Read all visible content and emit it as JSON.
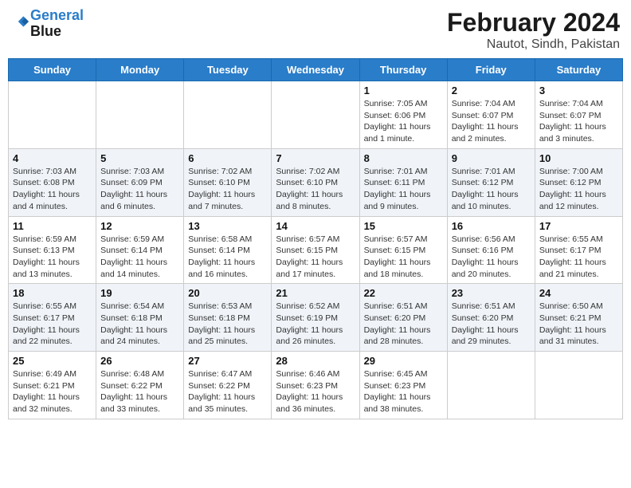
{
  "header": {
    "logo_line1": "General",
    "logo_line2": "Blue",
    "month_year": "February 2024",
    "location": "Nautot, Sindh, Pakistan"
  },
  "days_of_week": [
    "Sunday",
    "Monday",
    "Tuesday",
    "Wednesday",
    "Thursday",
    "Friday",
    "Saturday"
  ],
  "weeks": [
    [
      {
        "day": "",
        "info": ""
      },
      {
        "day": "",
        "info": ""
      },
      {
        "day": "",
        "info": ""
      },
      {
        "day": "",
        "info": ""
      },
      {
        "day": "1",
        "info": "Sunrise: 7:05 AM\nSunset: 6:06 PM\nDaylight: 11 hours and 1 minute."
      },
      {
        "day": "2",
        "info": "Sunrise: 7:04 AM\nSunset: 6:07 PM\nDaylight: 11 hours and 2 minutes."
      },
      {
        "day": "3",
        "info": "Sunrise: 7:04 AM\nSunset: 6:07 PM\nDaylight: 11 hours and 3 minutes."
      }
    ],
    [
      {
        "day": "4",
        "info": "Sunrise: 7:03 AM\nSunset: 6:08 PM\nDaylight: 11 hours and 4 minutes."
      },
      {
        "day": "5",
        "info": "Sunrise: 7:03 AM\nSunset: 6:09 PM\nDaylight: 11 hours and 6 minutes."
      },
      {
        "day": "6",
        "info": "Sunrise: 7:02 AM\nSunset: 6:10 PM\nDaylight: 11 hours and 7 minutes."
      },
      {
        "day": "7",
        "info": "Sunrise: 7:02 AM\nSunset: 6:10 PM\nDaylight: 11 hours and 8 minutes."
      },
      {
        "day": "8",
        "info": "Sunrise: 7:01 AM\nSunset: 6:11 PM\nDaylight: 11 hours and 9 minutes."
      },
      {
        "day": "9",
        "info": "Sunrise: 7:01 AM\nSunset: 6:12 PM\nDaylight: 11 hours and 10 minutes."
      },
      {
        "day": "10",
        "info": "Sunrise: 7:00 AM\nSunset: 6:12 PM\nDaylight: 11 hours and 12 minutes."
      }
    ],
    [
      {
        "day": "11",
        "info": "Sunrise: 6:59 AM\nSunset: 6:13 PM\nDaylight: 11 hours and 13 minutes."
      },
      {
        "day": "12",
        "info": "Sunrise: 6:59 AM\nSunset: 6:14 PM\nDaylight: 11 hours and 14 minutes."
      },
      {
        "day": "13",
        "info": "Sunrise: 6:58 AM\nSunset: 6:14 PM\nDaylight: 11 hours and 16 minutes."
      },
      {
        "day": "14",
        "info": "Sunrise: 6:57 AM\nSunset: 6:15 PM\nDaylight: 11 hours and 17 minutes."
      },
      {
        "day": "15",
        "info": "Sunrise: 6:57 AM\nSunset: 6:15 PM\nDaylight: 11 hours and 18 minutes."
      },
      {
        "day": "16",
        "info": "Sunrise: 6:56 AM\nSunset: 6:16 PM\nDaylight: 11 hours and 20 minutes."
      },
      {
        "day": "17",
        "info": "Sunrise: 6:55 AM\nSunset: 6:17 PM\nDaylight: 11 hours and 21 minutes."
      }
    ],
    [
      {
        "day": "18",
        "info": "Sunrise: 6:55 AM\nSunset: 6:17 PM\nDaylight: 11 hours and 22 minutes."
      },
      {
        "day": "19",
        "info": "Sunrise: 6:54 AM\nSunset: 6:18 PM\nDaylight: 11 hours and 24 minutes."
      },
      {
        "day": "20",
        "info": "Sunrise: 6:53 AM\nSunset: 6:18 PM\nDaylight: 11 hours and 25 minutes."
      },
      {
        "day": "21",
        "info": "Sunrise: 6:52 AM\nSunset: 6:19 PM\nDaylight: 11 hours and 26 minutes."
      },
      {
        "day": "22",
        "info": "Sunrise: 6:51 AM\nSunset: 6:20 PM\nDaylight: 11 hours and 28 minutes."
      },
      {
        "day": "23",
        "info": "Sunrise: 6:51 AM\nSunset: 6:20 PM\nDaylight: 11 hours and 29 minutes."
      },
      {
        "day": "24",
        "info": "Sunrise: 6:50 AM\nSunset: 6:21 PM\nDaylight: 11 hours and 31 minutes."
      }
    ],
    [
      {
        "day": "25",
        "info": "Sunrise: 6:49 AM\nSunset: 6:21 PM\nDaylight: 11 hours and 32 minutes."
      },
      {
        "day": "26",
        "info": "Sunrise: 6:48 AM\nSunset: 6:22 PM\nDaylight: 11 hours and 33 minutes."
      },
      {
        "day": "27",
        "info": "Sunrise: 6:47 AM\nSunset: 6:22 PM\nDaylight: 11 hours and 35 minutes."
      },
      {
        "day": "28",
        "info": "Sunrise: 6:46 AM\nSunset: 6:23 PM\nDaylight: 11 hours and 36 minutes."
      },
      {
        "day": "29",
        "info": "Sunrise: 6:45 AM\nSunset: 6:23 PM\nDaylight: 11 hours and 38 minutes."
      },
      {
        "day": "",
        "info": ""
      },
      {
        "day": "",
        "info": ""
      }
    ]
  ]
}
